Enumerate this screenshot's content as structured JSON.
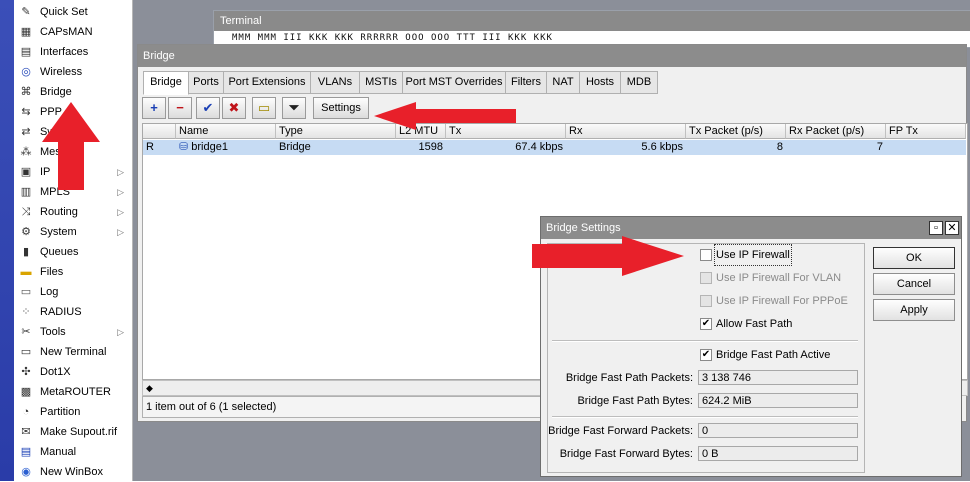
{
  "menu": {
    "items": [
      {
        "label": "Quick Set",
        "icon": "wand-icon",
        "submenu": false
      },
      {
        "label": "CAPsMAN",
        "icon": "capsman-icon",
        "submenu": false
      },
      {
        "label": "Interfaces",
        "icon": "interfaces-icon",
        "submenu": false
      },
      {
        "label": "Wireless",
        "icon": "wireless-icon",
        "submenu": false
      },
      {
        "label": "Bridge",
        "icon": "bridge-icon",
        "submenu": false
      },
      {
        "label": "PPP",
        "icon": "ppp-icon",
        "submenu": false
      },
      {
        "label": "Sw",
        "icon": "switch-icon",
        "submenu": false
      },
      {
        "label": "Mes",
        "icon": "mesh-icon",
        "submenu": false
      },
      {
        "label": "IP",
        "icon": "ip-icon",
        "submenu": true
      },
      {
        "label": "MPLS",
        "icon": "mpls-icon",
        "submenu": true
      },
      {
        "label": "Routing",
        "icon": "routing-icon",
        "submenu": true
      },
      {
        "label": "System",
        "icon": "system-gear-icon",
        "submenu": true
      },
      {
        "label": "Queues",
        "icon": "queues-icon",
        "submenu": false
      },
      {
        "label": "Files",
        "icon": "folder-icon",
        "submenu": false
      },
      {
        "label": "Log",
        "icon": "log-icon",
        "submenu": false
      },
      {
        "label": "RADIUS",
        "icon": "radius-icon",
        "submenu": false
      },
      {
        "label": "Tools",
        "icon": "tools-icon",
        "submenu": true
      },
      {
        "label": "New Terminal",
        "icon": "terminal-icon",
        "submenu": false
      },
      {
        "label": "Dot1X",
        "icon": "dot1x-icon",
        "submenu": false
      },
      {
        "label": "MetaROUTER",
        "icon": "metarouter-icon",
        "submenu": false
      },
      {
        "label": "Partition",
        "icon": "partition-icon",
        "submenu": false
      },
      {
        "label": "Make Supout.rif",
        "icon": "supout-icon",
        "submenu": false
      },
      {
        "label": "Manual",
        "icon": "manual-icon",
        "submenu": false
      },
      {
        "label": "New WinBox",
        "icon": "winbox-icon",
        "submenu": false
      }
    ]
  },
  "terminal": {
    "title": "Terminal",
    "line": "MMM     MMM   III   KKK KKK    RRRRRR    OOO  OOO      TTT      III   KKK KKK"
  },
  "bridge_window": {
    "title": "Bridge",
    "tabs": [
      "Bridge",
      "Ports",
      "Port Extensions",
      "VLANs",
      "MSTIs",
      "Port MST Overrides",
      "Filters",
      "NAT",
      "Hosts",
      "MDB"
    ],
    "toolbar": {
      "add": "+",
      "remove": "−",
      "enable": "✔",
      "disable": "✖",
      "comment": "▭",
      "filter": "⏷",
      "settings_label": "Settings"
    },
    "columns": [
      "",
      "Name",
      "Type",
      "L2 MTU",
      "Tx",
      "Rx",
      "Tx Packet (p/s)",
      "Rx Packet (p/s)",
      "FP Tx"
    ],
    "rows": [
      {
        "flag": "R",
        "name": "bridge1",
        "type": "Bridge",
        "l2mtu": "1598",
        "tx": "67.4 kbps",
        "rx": "5.6 kbps",
        "txp": "8",
        "rxp": "7",
        "fptx": ""
      }
    ],
    "status": "1 item out of 6 (1 selected)"
  },
  "settings_dialog": {
    "title": "Bridge Settings",
    "checkboxes": {
      "use_ip_firewall": {
        "label": "Use IP Firewall",
        "checked": false,
        "enabled": true
      },
      "use_ip_firewall_vlan": {
        "label": "Use IP Firewall For VLAN",
        "checked": false,
        "enabled": false
      },
      "use_ip_firewall_pppoe": {
        "label": "Use IP Firewall For PPPoE",
        "checked": false,
        "enabled": false
      },
      "allow_fast_path": {
        "label": "Allow Fast Path",
        "checked": true,
        "enabled": true
      },
      "fast_path_active": {
        "label": "Bridge Fast Path Active",
        "checked": true,
        "enabled": true
      }
    },
    "fields": {
      "fp_packets": {
        "label": "Bridge Fast Path Packets:",
        "value": "3 138 746"
      },
      "fp_bytes": {
        "label": "Bridge Fast Path Bytes:",
        "value": "624.2 MiB"
      },
      "ff_packets": {
        "label": "Bridge Fast Forward Packets:",
        "value": "0"
      },
      "ff_bytes": {
        "label": "Bridge Fast Forward Bytes:",
        "value": "0 B"
      }
    },
    "buttons": {
      "ok": "OK",
      "cancel": "Cancel",
      "apply": "Apply"
    },
    "window_icons": {
      "restore": "restore-icon",
      "close": "close-icon"
    }
  },
  "colors": {
    "annotation_arrow": "#e8202a",
    "selected_row": "#c6dbf3",
    "titlebar": "#8c8c8c",
    "stripe": "#3b4fb8"
  }
}
